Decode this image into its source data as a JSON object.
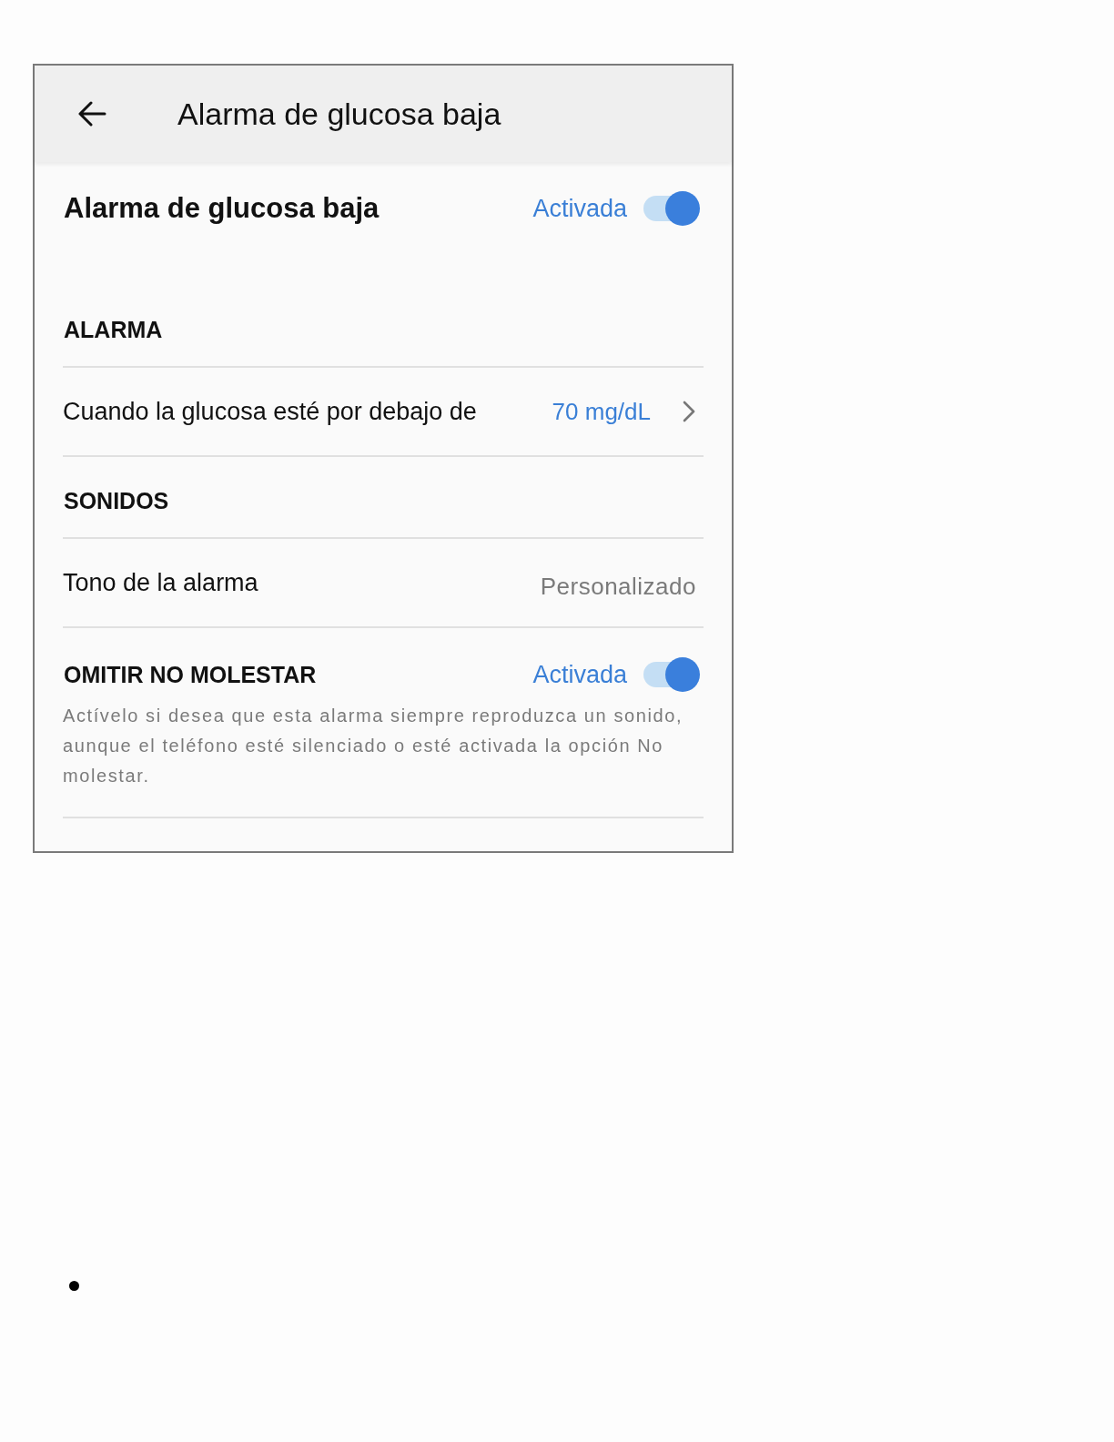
{
  "header": {
    "title": "Alarma de glucosa baja"
  },
  "main_toggle": {
    "label": "Alarma de glucosa baja",
    "status": "Activada",
    "on": true
  },
  "sections": [
    {
      "heading": "ALARMA",
      "rows": [
        {
          "kind": "link",
          "label": "Cuando la glucosa esté por debajo de",
          "value": "70 mg/dL"
        }
      ]
    },
    {
      "heading": "SONIDOS",
      "rows": [
        {
          "kind": "value",
          "label": "Tono de la alarma",
          "value": "Personalizado"
        }
      ]
    }
  ],
  "override": {
    "label": "OMITIR NO MOLESTAR",
    "status": "Activada",
    "on": true,
    "description": "Actívelo si desea que esta alarma siempre reproduzca un sonido, aunque el teléfono esté silenciado o esté activada la opción No molestar."
  }
}
